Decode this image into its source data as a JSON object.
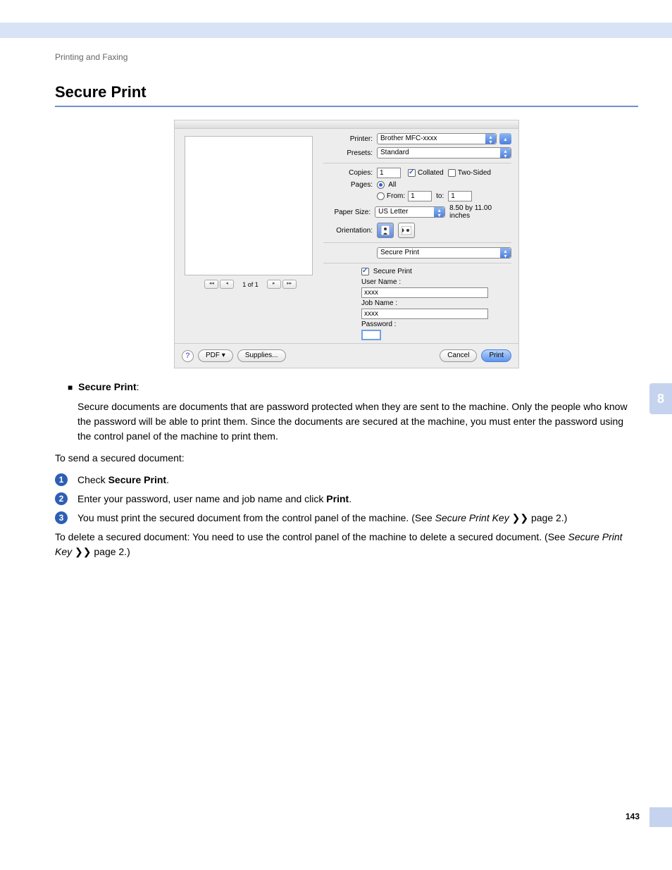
{
  "header": {
    "running": "Printing and Faxing"
  },
  "section": {
    "title": "Secure Print"
  },
  "dialog": {
    "preview_nav": {
      "first": "◂◂",
      "prev": "◂",
      "pos": "1 of 1",
      "next": "▸",
      "last": "▸▸"
    },
    "labels": {
      "printer": "Printer:",
      "presets": "Presets:",
      "copies": "Copies:",
      "collated": "Collated",
      "two_sided": "Two-Sided",
      "pages": "Pages:",
      "all": "All",
      "from": "From:",
      "to": "to:",
      "paper_size": "Paper Size:",
      "paper_dim": "8.50 by 11.00 inches",
      "orientation": "Orientation:",
      "pane_name": "Secure Print",
      "sp_check": "Secure Print",
      "user_name": "User Name :",
      "job_name": "Job Name :",
      "password": "Password :"
    },
    "values": {
      "printer": "Brother MFC-xxxx",
      "presets": "Standard",
      "copies": "1",
      "from": "1",
      "to": "1",
      "paper_size": "US Letter",
      "user_name": "xxxx",
      "job_name": "xxxx",
      "password": ""
    },
    "footer": {
      "pdf": "PDF ▾",
      "supplies": "Supplies...",
      "cancel": "Cancel",
      "print": "Print"
    }
  },
  "body": {
    "bullet_title": "Secure Print",
    "bullet_colon": ":",
    "desc": "Secure documents are documents that are password protected when they are sent to the machine. Only the people who know the password will be able to print them. Since the documents are secured at the machine, you must enter the password using the control panel of the machine to print them.",
    "send_intro": "To send a secured document:",
    "step1_a": "Check ",
    "step1_b": "Secure Print",
    "step1_c": ".",
    "step2_a": "Enter your password, user name and job name and click ",
    "step2_b": "Print",
    "step2_c": ".",
    "step3_a": "You must print the secured document from the control panel of the machine. (See ",
    "step3_b": "Secure Print Key",
    "step3_c": " ❯❯ page 2.)",
    "delete_a": "To delete a secured document: You need to use the control panel of the machine to delete a secured document. (See ",
    "delete_b": "Secure Print Key",
    "delete_c": " ❯❯ page 2.)"
  },
  "page": {
    "chapter": "8",
    "number": "143"
  }
}
